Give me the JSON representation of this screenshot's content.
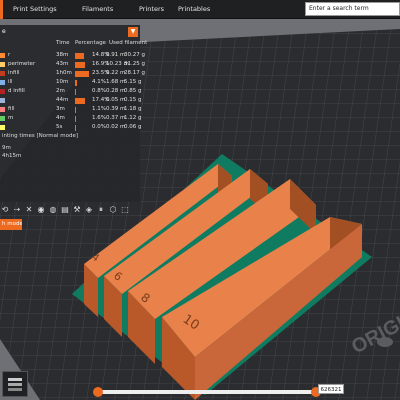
{
  "topbar": {
    "tabs": [
      "Print Settings",
      "Filaments",
      "Printers",
      "Printables"
    ],
    "search_placeholder": "Enter a search term"
  },
  "legend": {
    "view_label": "e",
    "headers": {
      "time": "Time",
      "percentage": "Percentage",
      "used_filament": "Used filament"
    },
    "rows": [
      {
        "feature": "r",
        "time": "38m",
        "pct": "14.8%",
        "length": "9.91 m",
        "weight": "30.27 g",
        "bar": 0.148
      },
      {
        "feature": "perimeter",
        "time": "43m",
        "pct": "16.9%",
        "length": "10.23 m",
        "weight": "31.25 g",
        "bar": 0.169
      },
      {
        "feature": "infill",
        "time": "1h0m",
        "pct": "23.5%",
        "length": "9.22 m",
        "weight": "28.17 g",
        "bar": 0.235
      },
      {
        "feature": "ill",
        "time": "10m",
        "pct": "4.1%",
        "length": "1.68 m",
        "weight": "5.15 g",
        "bar": 0.041
      },
      {
        "feature": "d infill",
        "time": "2m",
        "pct": "0.8%",
        "length": "0.28 m",
        "weight": "0.85 g",
        "bar": 0.008
      },
      {
        "feature": "",
        "time": "44m",
        "pct": "17.4%",
        "length": "0.05 m",
        "weight": "0.15 g",
        "bar": 0.174
      },
      {
        "feature": "fill",
        "time": "3m",
        "pct": "1.1%",
        "length": "0.39 m",
        "weight": "1.18 g",
        "bar": 0.011
      },
      {
        "feature": "m",
        "time": "4m",
        "pct": "1.6%",
        "length": "0.37 m",
        "weight": "1.12 g",
        "bar": 0.016
      },
      {
        "feature": "",
        "time": "5s",
        "pct": "0.0%",
        "length": "0.02 m",
        "weight": "0.06 g",
        "bar": 0.0
      }
    ],
    "footer_times": "inting times [Normal mode]",
    "footer_line1": "9m",
    "footer_line2": "4h15m",
    "mode_button": "h mode",
    "icons": [
      "extrusion-icon",
      "travel-icon",
      "wipe-icon",
      "retraction-icon",
      "deretraction-icon",
      "seam-icon",
      "tool-change-icon",
      "color-change-icon",
      "pause-icon",
      "shells-icon",
      "sequential-icon"
    ]
  },
  "bed": {
    "brand_text": "ORIGINAL"
  },
  "models": {
    "labels": [
      "4",
      "6",
      "8",
      "10"
    ],
    "color": "#e2773e"
  },
  "bottom": {
    "move_count": "626321",
    "slider_fraction": 1.0
  },
  "colors": {
    "accent": "#ed6b21",
    "bed": "#2a2b2e",
    "skirt": "#0e8a69",
    "model": "#e2773e"
  }
}
